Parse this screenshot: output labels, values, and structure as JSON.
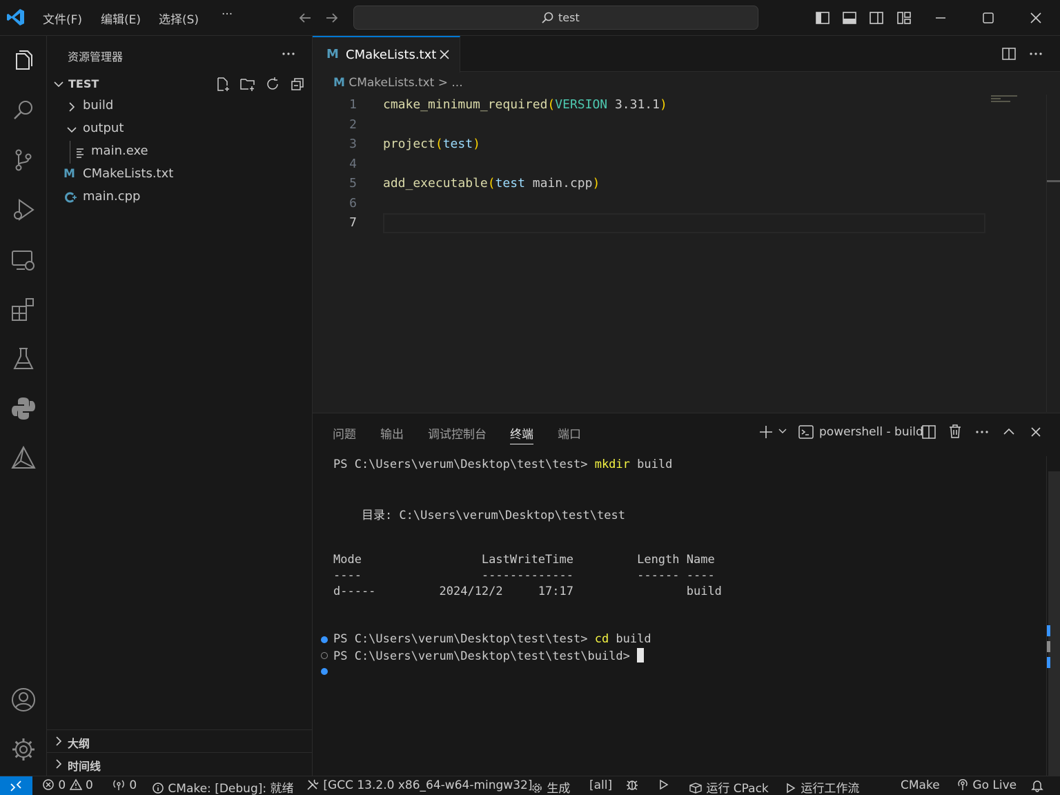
{
  "titlebar": {
    "menus": [
      "文件(F)",
      "编辑(E)",
      "选择(S)",
      "···"
    ],
    "search_text": "test"
  },
  "sidebar": {
    "title": "资源管理器",
    "folder": "TEST",
    "tree": [
      {
        "label": "build",
        "type": "folder",
        "expanded": false
      },
      {
        "label": "output",
        "type": "folder",
        "expanded": true
      },
      {
        "label": "main.exe",
        "type": "file"
      },
      {
        "label": "CMakeLists.txt",
        "type": "cmake"
      },
      {
        "label": "main.cpp",
        "type": "cpp"
      }
    ],
    "sections": [
      "大纲",
      "时间线"
    ]
  },
  "editor": {
    "tab_label": "CMakeLists.txt",
    "tab_icon": "M",
    "breadcrumb": "CMakeLists.txt > ...",
    "line_numbers": [
      "1",
      "2",
      "3",
      "4",
      "5",
      "6",
      "7"
    ],
    "code": {
      "l1_fn": "cmake_minimum_required",
      "l1_kw": "VERSION",
      "l1_val": " 3.31.1",
      "l3_fn": "project",
      "l3_arg": "test",
      "l5_fn": "add_executable",
      "l5_arg1": "test",
      "l5_arg2": " main.cpp"
    }
  },
  "panel": {
    "tabs": [
      "问题",
      "输出",
      "调试控制台",
      "终端",
      "端口"
    ],
    "active_tab": "终端",
    "terminal_name": "powershell - build",
    "lines": {
      "prompt1": "PS C:\\Users\\verum\\Desktop\\test\\test> ",
      "cmd1": "mkdir",
      "arg1": " build",
      "dir_line": "    目录: C:\\Users\\verum\\Desktop\\test\\test",
      "header": "Mode                 LastWriteTime         Length Name",
      "sep": "----                 -------------         ------ ----",
      "row": "d-----         2024/12/2     17:17                build",
      "prompt2": "PS C:\\Users\\verum\\Desktop\\test\\test> ",
      "cmd2": "cd",
      "arg2": " build",
      "prompt3": "PS C:\\Users\\verum\\Desktop\\test\\test\\build> "
    }
  },
  "statusbar": {
    "errors": "0",
    "warnings": "0",
    "ports": "0",
    "cmake_status": "CMake: [Debug]: 就绪",
    "kit": "[GCC 13.2.0 x86_64-w64-mingw32]",
    "build": "生成",
    "target": "[all]",
    "cpack": "运行 CPack",
    "workflow": "运行工作流",
    "cmake": "CMake",
    "golive": "Go Live"
  },
  "colors": {
    "accent": "#0078d4",
    "function": "#dcdcaa",
    "keyword": "#4ec9b0",
    "variable": "#9cdcfe",
    "bracket": "#ffd700"
  }
}
